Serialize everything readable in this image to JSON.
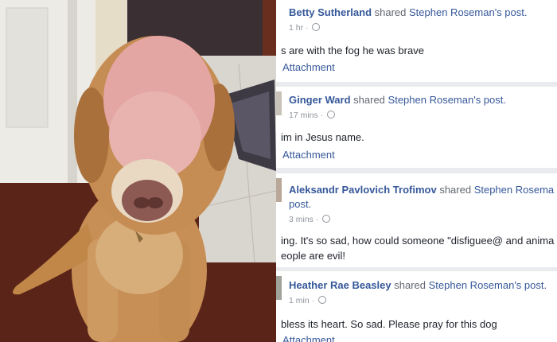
{
  "posts": [
    {
      "author": "Betty Sutherland",
      "shared": "shared",
      "original_owner": "Stephen Roseman's post.",
      "time": "1 hr ·",
      "text": "s are with the fog he was brave",
      "attachment": "Attachment"
    },
    {
      "author": "Ginger Ward",
      "shared": "shared",
      "original_owner": "Stephen Roseman's post.",
      "time": "17 mins ·",
      "text": "im in Jesus name.",
      "attachment": "Attachment"
    },
    {
      "author": "Aleksandr Pavlovich Trofimov",
      "shared": "shared",
      "original_owner": "Stephen Rosema",
      "original_owner_wrap": "post.",
      "time": "3 mins ·",
      "text_line1": "ing. It's so sad, how could someone \"disfiguee@ and anima",
      "text_line2": "eople are evil!"
    },
    {
      "author": "Heather Rae Beasley",
      "shared": "shared",
      "original_owner": "Stephen Roseman's post.",
      "time": "1 min ·",
      "text": "bless its heart. So sad. Please pray for this dog",
      "attachment": "Attachment"
    }
  ],
  "colors": {
    "link": "#365899",
    "meta": "#90949c",
    "text": "#1d2129",
    "feed_bg": "#e9ebee"
  }
}
